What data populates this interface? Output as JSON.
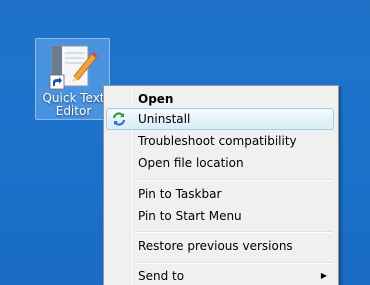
{
  "desktop": {
    "icon": {
      "label_line1": "Quick Text",
      "label_line2": "Editor",
      "icon_name": "text-editor-shortcut-icon"
    }
  },
  "context_menu": {
    "items": [
      {
        "label": "Open",
        "bold": true
      },
      {
        "label": "Uninstall",
        "icon_name": "uninstall-arrows-icon",
        "highlighted": true
      },
      {
        "label": "Troubleshoot compatibility"
      },
      {
        "label": "Open file location"
      },
      {
        "label": "Pin to Taskbar"
      },
      {
        "label": "Pin to Start Menu"
      },
      {
        "label": "Restore previous versions"
      },
      {
        "label": "Send to",
        "has_submenu": true,
        "arrow": "▶"
      }
    ]
  },
  "colors": {
    "desktop_blue": "#1d73cc",
    "menu_background": "#f0f0f0",
    "highlight_border": "#aeccdc",
    "highlight_fill": "#e4f2fa"
  }
}
